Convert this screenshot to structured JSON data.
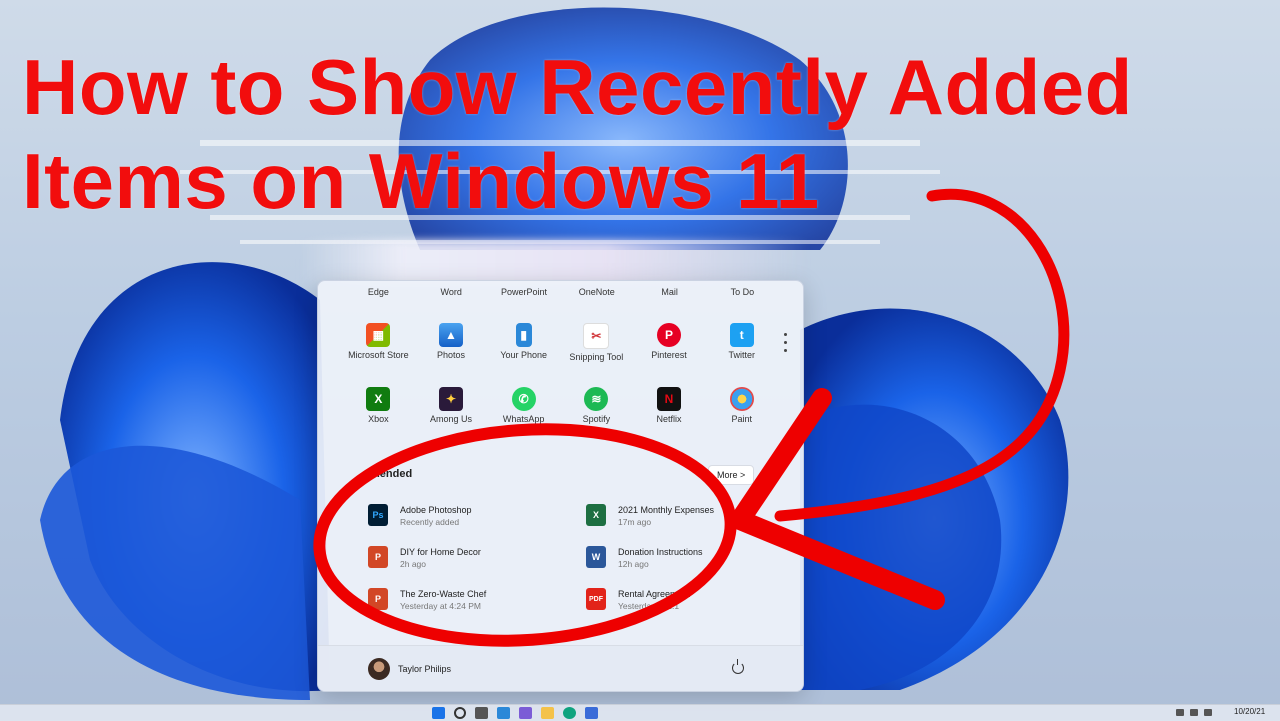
{
  "headline": {
    "line1": "How to Show Recently Added",
    "line2": "Items on Windows 11"
  },
  "colors": {
    "headline": "#f20d0d",
    "annotation": "#ee0000",
    "wallpaper_accent": "#1a63e8"
  },
  "start_menu": {
    "top_row": [
      "Edge",
      "Word",
      "PowerPoint",
      "OneNote",
      "Mail",
      "To Do"
    ],
    "pinned_row1": [
      {
        "label": "Microsoft Store",
        "icon": "store-icon"
      },
      {
        "label": "Photos",
        "icon": "photos-icon"
      },
      {
        "label": "Your Phone",
        "icon": "phone-icon"
      },
      {
        "label": "Snipping Tool",
        "icon": "scissors-icon"
      },
      {
        "label": "Pinterest",
        "icon": "pinterest-icon"
      },
      {
        "label": "Twitter",
        "icon": "twitter-icon"
      }
    ],
    "pinned_row2": [
      {
        "label": "Xbox",
        "icon": "xbox-icon"
      },
      {
        "label": "Among Us",
        "icon": "among-us-icon"
      },
      {
        "label": "WhatsApp",
        "icon": "whatsapp-icon"
      },
      {
        "label": "Spotify",
        "icon": "spotify-icon"
      },
      {
        "label": "Netflix",
        "icon": "netflix-icon"
      },
      {
        "label": "Paint",
        "icon": "paint-icon"
      }
    ],
    "recommended_title": "mended",
    "more_label": "More >",
    "recommended": [
      {
        "name": "Adobe Photoshop",
        "time": "Recently added",
        "icon": "photoshop-icon"
      },
      {
        "name": "2021 Monthly Expenses",
        "time": "17m ago",
        "icon": "excel-icon"
      },
      {
        "name": "DIY for Home Decor",
        "time": "2h ago",
        "icon": "powerpoint-icon"
      },
      {
        "name": "Donation Instructions",
        "time": "12h ago",
        "icon": "word-icon"
      },
      {
        "name": "The Zero-Waste Chef",
        "time": "Yesterday at 4:24 PM",
        "icon": "powerpoint-icon"
      },
      {
        "name": "Rental Agreement",
        "time": "Yesterday at 1:1",
        "icon": "pdf-icon"
      }
    ],
    "user_name": "Taylor Philips"
  },
  "taskbar": {
    "date": "10/20/21"
  }
}
